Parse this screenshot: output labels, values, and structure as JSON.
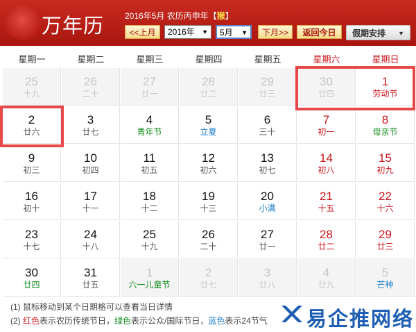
{
  "header": {
    "logo_text": "万年历",
    "subtitle_prefix": "2016年5月 农历丙申年【",
    "zodiac": "猴",
    "subtitle_suffix": "】",
    "prev_month": "<<上月",
    "year_value": "2016年",
    "month_value": "5月",
    "next_month": "下月>>",
    "back_today": "返回今日",
    "holiday_menu": "假期安排",
    "colors": {
      "header_red": "#b81c13",
      "weekend_red": "#c8161d"
    }
  },
  "weekdays": [
    "星期一",
    "星期二",
    "星期三",
    "星期四",
    "星期五",
    "星期六",
    "星期日"
  ],
  "days": [
    {
      "d": "25",
      "l": "十九",
      "out": true
    },
    {
      "d": "26",
      "l": "二十",
      "out": true
    },
    {
      "d": "27",
      "l": "廿一",
      "out": true
    },
    {
      "d": "28",
      "l": "廿二",
      "out": true
    },
    {
      "d": "29",
      "l": "廿三",
      "out": true
    },
    {
      "d": "30",
      "l": "廿四",
      "out": true
    },
    {
      "d": "1",
      "l": "劳动节",
      "lc": "red"
    },
    {
      "d": "2",
      "l": "廿六"
    },
    {
      "d": "3",
      "l": "廿七"
    },
    {
      "d": "4",
      "l": "青年节",
      "lc": "green"
    },
    {
      "d": "5",
      "l": "立夏",
      "lc": "blue"
    },
    {
      "d": "6",
      "l": "三十"
    },
    {
      "d": "7",
      "l": "初一"
    },
    {
      "d": "8",
      "l": "母亲节",
      "lc": "green"
    },
    {
      "d": "9",
      "l": "初三"
    },
    {
      "d": "10",
      "l": "初四"
    },
    {
      "d": "11",
      "l": "初五"
    },
    {
      "d": "12",
      "l": "初六"
    },
    {
      "d": "13",
      "l": "初七"
    },
    {
      "d": "14",
      "l": "初八"
    },
    {
      "d": "15",
      "l": "初九"
    },
    {
      "d": "16",
      "l": "初十"
    },
    {
      "d": "17",
      "l": "十一"
    },
    {
      "d": "18",
      "l": "十二"
    },
    {
      "d": "19",
      "l": "十三"
    },
    {
      "d": "20",
      "l": "小满",
      "lc": "blue"
    },
    {
      "d": "21",
      "l": "十五"
    },
    {
      "d": "22",
      "l": "十六"
    },
    {
      "d": "23",
      "l": "十七"
    },
    {
      "d": "24",
      "l": "十八"
    },
    {
      "d": "25",
      "l": "十九"
    },
    {
      "d": "26",
      "l": "二十"
    },
    {
      "d": "27",
      "l": "廿一"
    },
    {
      "d": "28",
      "l": "廿二"
    },
    {
      "d": "29",
      "l": "廿三"
    },
    {
      "d": "30",
      "l": "廿四",
      "lc": "green"
    },
    {
      "d": "31",
      "l": "廿五"
    },
    {
      "d": "1",
      "l": "六一儿童节",
      "lc": "green",
      "out": true
    },
    {
      "d": "2",
      "l": "廿七",
      "out": true
    },
    {
      "d": "3",
      "l": "廿八",
      "out": true
    },
    {
      "d": "4",
      "l": "廿九",
      "out": true
    },
    {
      "d": "5",
      "l": "芒种",
      "lc": "blue",
      "out": true
    }
  ],
  "footer": {
    "line1": "(1) 鼠标移动到某个日期格可以查看当日详情",
    "line2_prefix": "(2) ",
    "red_word": "红色",
    "red_desc": "表示农历传统节日，",
    "green_word": "绿色",
    "green_desc": "表示公众/国际节日，",
    "blue_word": "蓝色",
    "blue_desc": "表示24节气"
  },
  "watermark": {
    "text": "易企推网络"
  }
}
